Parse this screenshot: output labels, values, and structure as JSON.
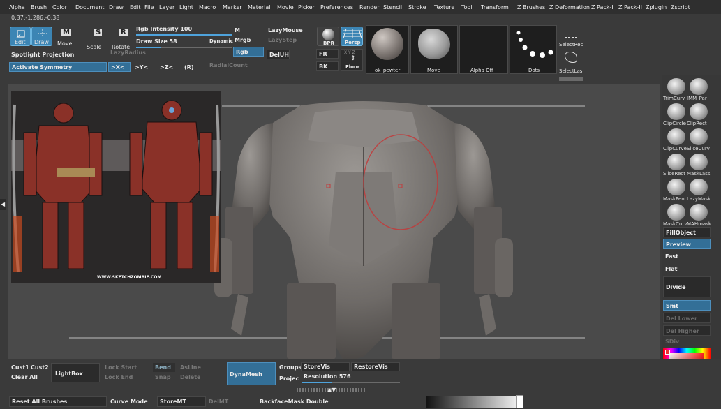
{
  "menu": [
    "Alpha",
    "Brush",
    "Color",
    "Document",
    "Draw",
    "Edit",
    "File",
    "Layer",
    "Light",
    "Macro",
    "Marker",
    "Material",
    "Movie",
    "Picker",
    "Preferences",
    "Render",
    "Stencil",
    "Stroke",
    "Texture",
    "Tool",
    "Transform",
    "Z Brushes",
    "Z Deformation",
    "Z Pack-I",
    "Z Pack-II",
    "Zplugin",
    "Zscript"
  ],
  "coords": "0.37,-1.286,-0.38",
  "tools": {
    "edit": "Edit",
    "draw": "Draw",
    "move": "Move",
    "scale": "Scale",
    "rotate": "Rotate",
    "move_letter": "M",
    "scale_letter": "S",
    "rotate_letter": "R"
  },
  "spotlight": "Spotlight Projection",
  "activate_symmetry": "Activate Symmetry",
  "sym": {
    "x": ">X<",
    "y": ">Y<",
    "z": ">Z<",
    "r": "(R)"
  },
  "rgb_intensity": "Rgb  Intensity 100",
  "draw_size": "Draw  Size 58",
  "dynamic": "Dynamic",
  "lazy_radius": "LazyRadius",
  "radial_count": "RadialCount",
  "m": "M",
  "mrgb": "Mrgb",
  "rgb": "Rgb",
  "lazy_mouse": "LazyMouse",
  "lazy_step": "LazyStep",
  "deluh": "DelUH",
  "bpr": "BPR",
  "persp": "Persp",
  "fr": "FR",
  "bk": "BK",
  "floor": "Floor",
  "xyz": "X Y Z",
  "thumbs": {
    "material": "ok_pewter",
    "brush": "Move",
    "alpha": "Alpha  Off",
    "stroke": "Dots"
  },
  "select_rect": "SelectRec",
  "select_lasso": "SelectLas",
  "ref_caption": "WWW.SKETCHZOMBIE.COM",
  "right_panel": {
    "icons": [
      [
        "TrimCurv",
        "IMM_Par"
      ],
      [
        "ClipCircle",
        "ClipRect"
      ],
      [
        "ClipCurve",
        "SliceCurv"
      ],
      [
        "SliceRect",
        "MaskLass"
      ],
      [
        "MaskPen",
        "LazyMask"
      ],
      [
        "MaskCurv",
        "MAHmask"
      ]
    ],
    "fill_object": "FillObject",
    "preview": "Preview",
    "fast": "Fast",
    "flat": "Flat",
    "divide": "Divide",
    "smt": "Smt",
    "del_lower": "Del  Lower",
    "del_higher": "Del  Higher",
    "sdiv": "SDiv"
  },
  "bottom": {
    "cust1": "Cust1",
    "cust2": "Cust2",
    "clear_all": "Clear  All",
    "lightbox": "LightBox",
    "lock_start": "Lock  Start",
    "lock_end": "Lock  End",
    "bend": "Bend",
    "snap": "Snap",
    "asline": "AsLine",
    "delete": "Delete",
    "dynamesh": "DynaMesh",
    "groups": "Groups",
    "projec": "Projec",
    "storevis": "StoreVis",
    "restorevis": "RestoreVis",
    "resolution": "Resolution 576",
    "reset_all_brushes": "Reset  All  Brushes",
    "curve_mode": "Curve  Mode",
    "storemt": "StoreMT",
    "delmt": "DelMT",
    "backface": "BackfaceMask  Double"
  }
}
